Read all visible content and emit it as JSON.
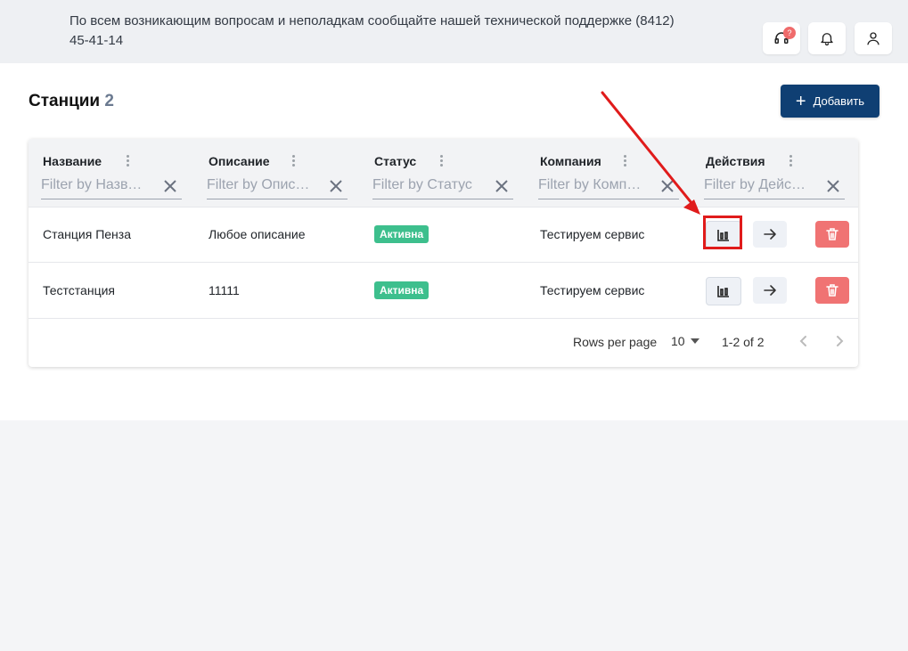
{
  "header": {
    "notice": "По всем возникающим вопросам и неполадкам сообщайте нашей технической поддержке (8412) 45-41-14",
    "support_badge": "?",
    "icons": [
      "headset-icon",
      "bell-icon",
      "user-icon"
    ]
  },
  "page": {
    "title": "Станции",
    "count": "2",
    "add_button": "Добавить"
  },
  "table": {
    "columns": [
      {
        "label": "Название",
        "filter_placeholder": "Filter by Название"
      },
      {
        "label": "Описание",
        "filter_placeholder": "Filter by Описание"
      },
      {
        "label": "Статус",
        "filter_placeholder": "Filter by Статус"
      },
      {
        "label": "Компания",
        "filter_placeholder": "Filter by Компания"
      },
      {
        "label": "Действия",
        "filter_placeholder": "Filter by Действия"
      }
    ],
    "rows": [
      {
        "name": "Станция Пенза",
        "description": "Любое описание",
        "status": "Активна",
        "company": "Тестируем сервис"
      },
      {
        "name": "Теcтстанция",
        "description": "11111",
        "status": "Активна",
        "company": "Тестируем сервис"
      }
    ],
    "footer": {
      "rows_per_page_label": "Rows per page",
      "rows_per_page_value": "10",
      "range": "1-2 of 2"
    }
  },
  "colors": {
    "accent": "#0f3f73",
    "status_active": "#3dbf8d",
    "delete": "#f07373",
    "annotation": "#e01b1b"
  }
}
